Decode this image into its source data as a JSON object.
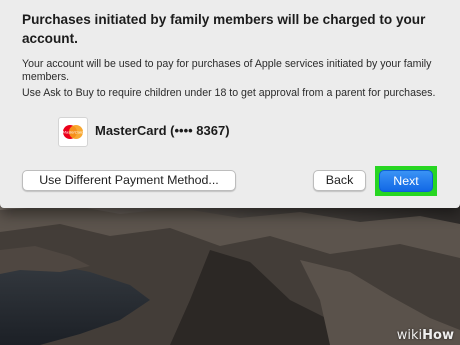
{
  "dialog": {
    "heading": "Purchases initiated by family members will be charged to your account.",
    "paragraph1": "Your account will be used to pay for purchases of Apple services initiated by your family members.",
    "paragraph2": "Use Ask to Buy to require children under 18 to get approval from a parent for purchases.",
    "payment_method": {
      "icon": "mastercard-icon",
      "logo_text": "MasterCard",
      "label": "MasterCard (•••• 8367)"
    },
    "buttons": {
      "different_payment": "Use Different Payment Method...",
      "back": "Back",
      "next": "Next"
    }
  },
  "watermark": {
    "prefix": "wiki",
    "suffix": "How"
  },
  "colors": {
    "sheet_background": "#ececec",
    "primary_button": "#1a73ea",
    "highlight_outline": "#27d622",
    "mastercard_red": "#eb001b",
    "mastercard_orange": "#f79e1b"
  }
}
